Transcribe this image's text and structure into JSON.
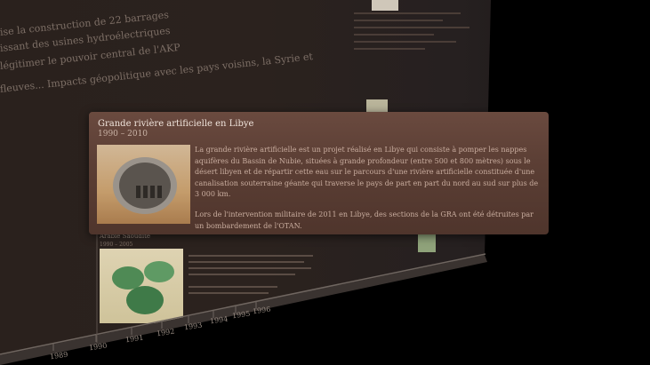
{
  "background_text": {
    "line1": "ise la construction de 22 barrages",
    "line2": "issant des usines hydroélectriques",
    "line3": "légitimer le pouvoir central de l'AKP",
    "line4": "fleuves... Impacts géopolitique avec les pays voisins, la Syrie et"
  },
  "tooltip": {
    "title": "Grande rivière artificielle en Libye",
    "date": "1990 – 2010",
    "paragraph1": "La grande rivière artificielle est un projet réalisé en Libye qui consiste à pomper les nappes aquifères du Bassin de Nubie, situées à grande profondeur (entre 500 et 800 mètres) sous le désert libyen et de répartir cette eau sur le parcours d'une rivière artificielle constituée d'une canalisation souterraine géante qui traverse le pays de part en part du nord au sud sur plus de 3 000 km.",
    "paragraph2": "Lors de l'intervention militaire de 2011 en Libye, des sections de la GRA ont été détruites par un bombardement de l'OTAN."
  },
  "lower_card": {
    "title": "Arabie Saoudite",
    "date": "1990 – 2005"
  },
  "timeline": {
    "years": [
      "1989",
      "1990",
      "1991",
      "1992",
      "1993",
      "1994",
      "1995",
      "1996"
    ]
  },
  "colors": {
    "wall": "#2a211d",
    "tooltip_bg": "#5c3f35",
    "text": "#c9ad9f"
  }
}
